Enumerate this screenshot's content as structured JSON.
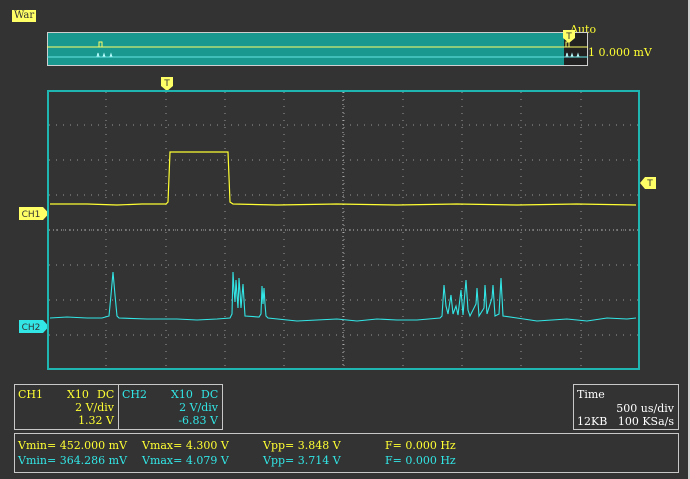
{
  "header": {
    "status_badge": "War",
    "trigger_mode": "Auto",
    "trigger_edge_icon": "rising-edge-icon",
    "trigger_info": "CH1 0.000 mV"
  },
  "markers": {
    "trigger": "T",
    "ch1": "CH1",
    "ch2": "CH2"
  },
  "channels": {
    "ch1": {
      "name": "CH1",
      "probe": "X10",
      "coupling": "DC",
      "volts_div": "2 V/div",
      "offset": "1.32 V",
      "color": "#ffff33"
    },
    "ch2": {
      "name": "CH2",
      "probe": "X10",
      "coupling": "DC",
      "volts_div": "2 V/div",
      "offset": "-6.83 V",
      "color": "#33e6e6"
    }
  },
  "timebase": {
    "title": "Time",
    "time_div": "500 us/div",
    "memory": "12KB",
    "sample_rate": "100 KSa/s"
  },
  "measurements": [
    {
      "vmin": "Vmin= 452.000 mV",
      "vmax": "Vmax= 4.300 V",
      "vpp": "Vpp= 3.848 V",
      "freq": "F= 0.000 Hz"
    },
    {
      "vmin": "Vmin= 364.286 mV",
      "vmax": "Vmax= 4.079 V",
      "vpp": "Vpp= 3.714 V",
      "freq": "F= 0.000 Hz"
    }
  ],
  "colors": {
    "grid_border": "#1fb5b0",
    "overview_bg": "#1a9b94",
    "screen_bg": "#333333"
  }
}
